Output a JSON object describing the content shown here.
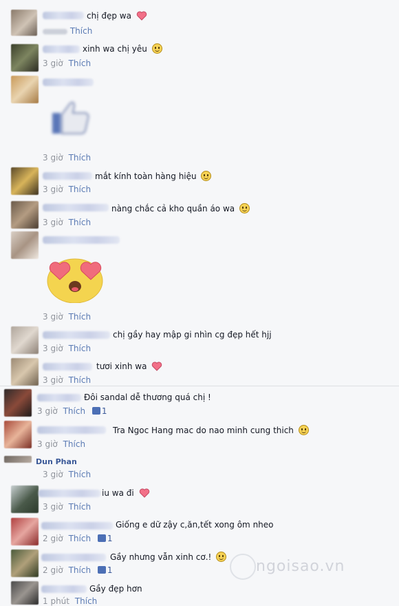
{
  "comments": [
    {
      "text": "chị đẹp wa",
      "time": "",
      "like": "Thích",
      "emoji": "heart"
    },
    {
      "text": "xinh wa chị yêu",
      "time": "3 giờ",
      "like": "Thích",
      "emoji": "smile"
    },
    {
      "text": "",
      "time": "3 giờ",
      "like": "Thích",
      "sticker": "like-thumb"
    },
    {
      "text": "mắt kính toàn hàng hiệu",
      "time": "3 giờ",
      "like": "Thích",
      "emoji": "smile"
    },
    {
      "text": "nàng chắc cả kho quần áo wa",
      "time": "3 giờ",
      "like": "Thích",
      "emoji": "smile"
    },
    {
      "text": "",
      "time": "3 giờ",
      "like": "Thích",
      "sticker": "heart-eyes"
    },
    {
      "text": "chị gầy hay mập gi nhìn cg đẹp hết hjj",
      "time": "3 giờ",
      "like": "Thích"
    },
    {
      "text": "tươi xinh wa",
      "time": "3 giờ",
      "like": "Thích",
      "emoji": "heart"
    },
    {
      "text": "Đôi sandal dễ thương quá chị !",
      "time": "3 giờ",
      "like": "Thích",
      "likes": "1"
    },
    {
      "text": "Tra Ngoc Hang mac do nao minh cung thich",
      "time": "3 giờ",
      "like": "Thích",
      "emoji": "smile"
    },
    {
      "name": "Dun Phan",
      "text": "",
      "time": "3 giờ",
      "like": "Thích"
    },
    {
      "text": "iu wa đi",
      "time": "3 giờ",
      "like": "Thích",
      "emoji": "heart"
    },
    {
      "text": "Giống e dữ zậy c,ăn,tết xong ôm nheo",
      "time": "2 giờ",
      "like": "Thích",
      "likes": "1"
    },
    {
      "text": "Gầy nhưng vẫn xinh cơ.!",
      "time": "2 giờ",
      "like": "Thích",
      "likes": "1",
      "emoji": "smile"
    },
    {
      "text": "Gầy đẹp hơn",
      "time": "1 phút",
      "like": "Thích"
    }
  ],
  "watermark": "ngoisao.vn",
  "colors": {
    "link": "#3b5998",
    "meta": "#90949c",
    "background": "#f6f7f9"
  }
}
